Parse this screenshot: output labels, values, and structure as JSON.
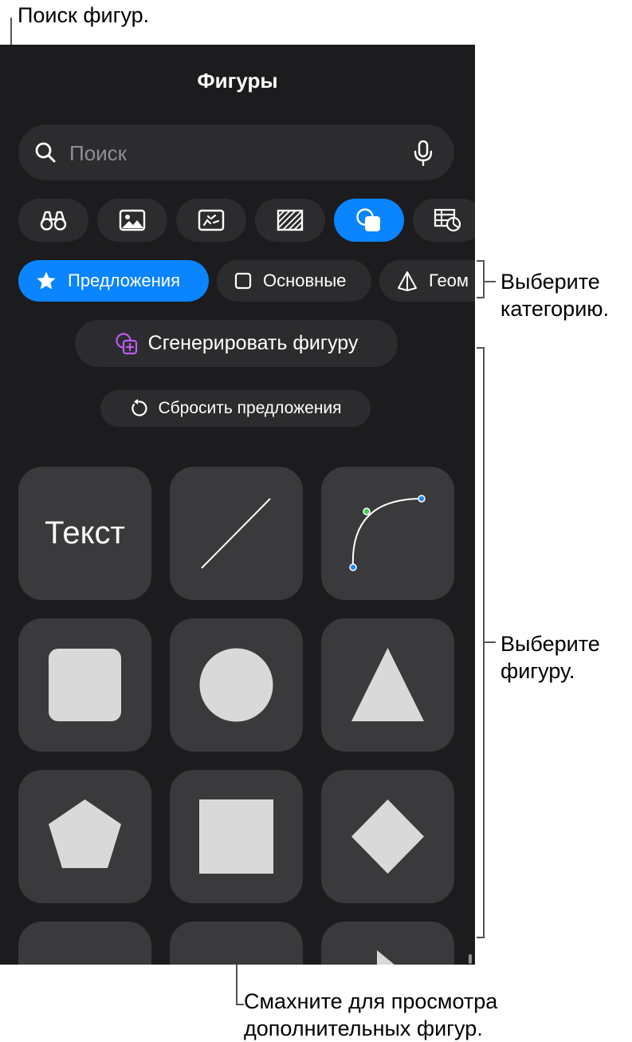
{
  "callouts": {
    "search": "Поиск фигур.",
    "category_line1": "Выберите",
    "category_line2": "категорию.",
    "shape_line1": "Выберите",
    "shape_line2": "фигуру.",
    "swipe_line1": "Смахните для просмотра",
    "swipe_line2": "дополнительных фигур."
  },
  "panel": {
    "title": "Фигуры",
    "search": {
      "placeholder": "Поиск",
      "icon": "magnifier-icon",
      "mic_icon": "microphone-icon"
    },
    "tabs": [
      {
        "icon": "binoculars-icon",
        "active": false
      },
      {
        "icon": "photo-icon",
        "active": false
      },
      {
        "icon": "photo-sticker-icon",
        "active": false
      },
      {
        "icon": "pattern-icon",
        "active": false
      },
      {
        "icon": "shapes-icon",
        "active": true
      },
      {
        "icon": "table-chart-icon",
        "active": false
      }
    ],
    "categories": [
      {
        "label": "Предложения",
        "icon": "star-icon",
        "active": true
      },
      {
        "label": "Основные",
        "icon": "square-outline-icon",
        "active": false
      },
      {
        "label": "Геом",
        "icon": "pyramid-icon",
        "active": false
      }
    ],
    "generate_label": "Сгенерировать фигуру",
    "reset_label": "Сбросить предложения",
    "shapes": {
      "text_tile": "Текст",
      "tiles": [
        "text",
        "line",
        "curve",
        "rounded-square",
        "circle",
        "triangle",
        "pentagon",
        "square",
        "diamond",
        "partial",
        "partial",
        "arrow-partial"
      ]
    },
    "colors": {
      "panel_bg": "#1c1c1e",
      "accent": "#0a84ff",
      "tile_bg": "#3a3a3c",
      "shape_fill": "#d9d9d9"
    }
  }
}
